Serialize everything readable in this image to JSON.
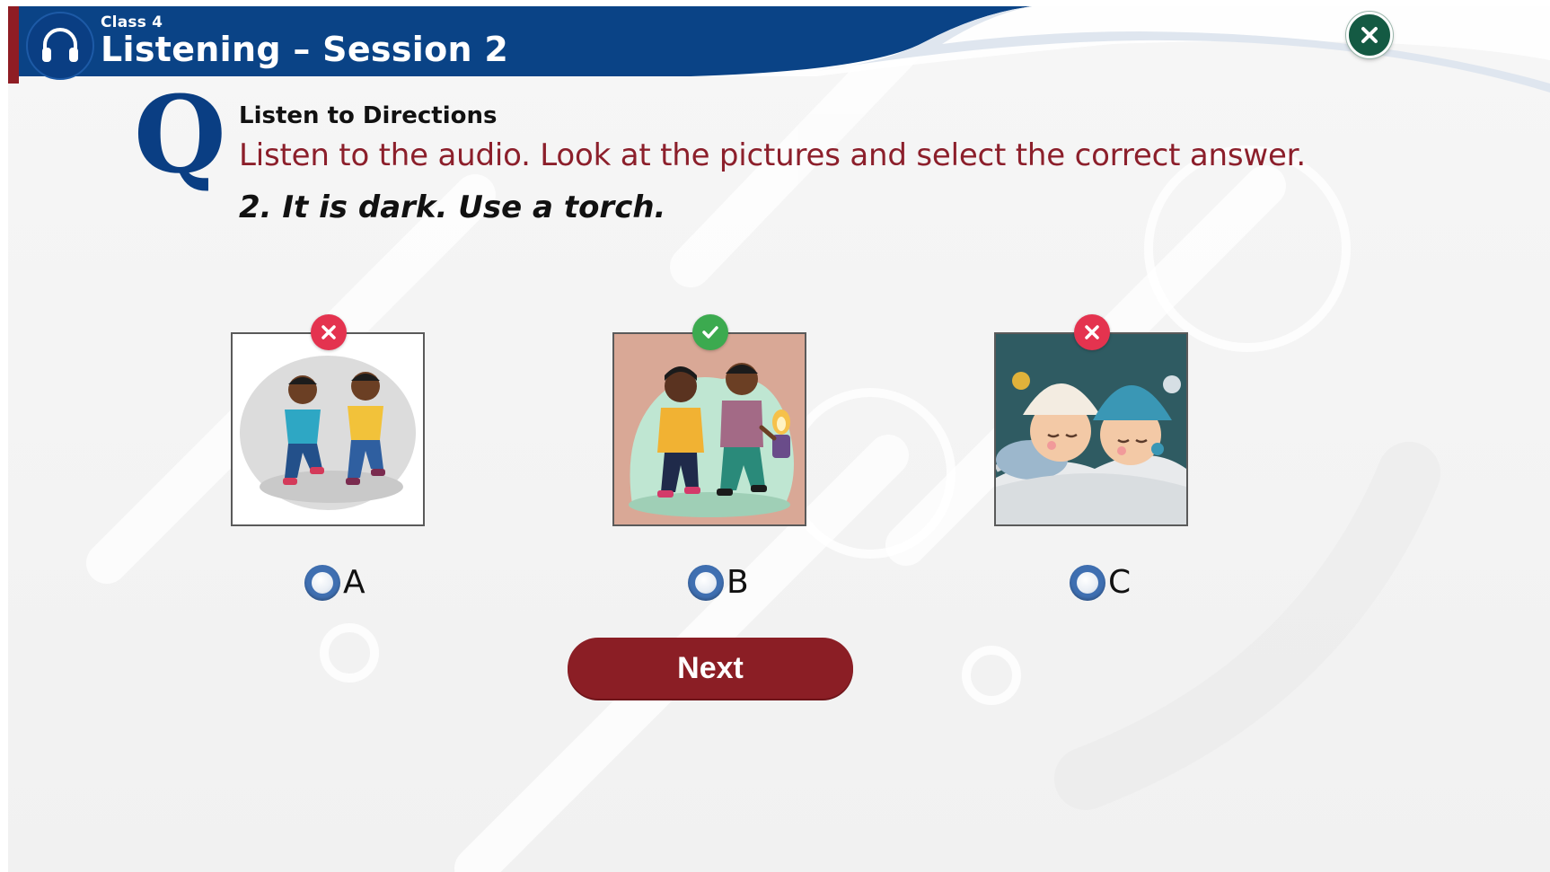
{
  "header": {
    "class_label": "Class 4",
    "title": "Listening – Session 2"
  },
  "question": {
    "heading": "Listen to Directions",
    "instruction": "Listen to the audio. Look at the pictures and select the correct answer.",
    "prompt": "2. It is dark. Use a torch."
  },
  "options": [
    {
      "letter": "A",
      "picture": "two boys running",
      "feedback": "incorrect"
    },
    {
      "letter": "B",
      "picture": "two children walking holding a lantern",
      "feedback": "correct"
    },
    {
      "letter": "C",
      "picture": "two children sleeping",
      "feedback": "incorrect"
    }
  ],
  "next_button": {
    "label": "Next"
  },
  "colors": {
    "header_blue": "#0a3e83",
    "accent_red": "#8b1e25",
    "instruction_red": "#8c1f2b",
    "correct_green": "#3caa4f",
    "wrong_red": "#e4334f",
    "close_green": "#145a43",
    "radio_blue": "#3f6fb1"
  },
  "icons": {
    "header": "headphones-icon",
    "close": "close-icon",
    "question_mark": "Q",
    "correct": "check-icon",
    "wrong": "cross-icon"
  }
}
